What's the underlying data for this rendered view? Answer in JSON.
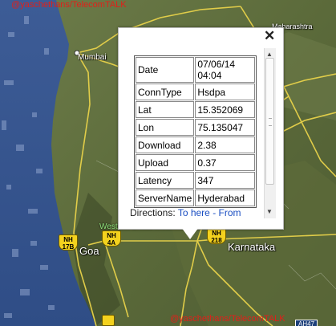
{
  "watermark": {
    "top": "@yaschethans/TelecomTALK",
    "bottom": "@yaschethans/TelecomTALK"
  },
  "map": {
    "places": {
      "mumbai": "Mumbai",
      "maharashtra": "Maharashtra",
      "goa": "Goa",
      "karnataka": "Karnataka",
      "ghats": "Western Ghats Mou"
    },
    "shields": {
      "nh17b_top": "NH",
      "nh17b_num": "17B",
      "nh4a_top": "NH",
      "nh4a_num": "4A",
      "nh218_top": "NH",
      "nh218_num": "218",
      "ah47": "AH47"
    },
    "colors": {
      "sea": "#3a5890",
      "land": "#5a6a3c",
      "road": "#e8d24a"
    }
  },
  "balloon": {
    "close_label": "✕",
    "table": [
      {
        "key": "Date",
        "value": "07/06/14 04:04"
      },
      {
        "key": "ConnType",
        "value": "Hsdpa"
      },
      {
        "key": "Lat",
        "value": "15.352069"
      },
      {
        "key": "Lon",
        "value": "75.135047"
      },
      {
        "key": "Download",
        "value": "2.38"
      },
      {
        "key": "Upload",
        "value": "0.37"
      },
      {
        "key": "Latency",
        "value": "347"
      },
      {
        "key": "ServerName",
        "value": "Hyderabad"
      }
    ],
    "directions_label": "Directions:",
    "to_here": "To here",
    "separator": "-",
    "from": "From"
  }
}
